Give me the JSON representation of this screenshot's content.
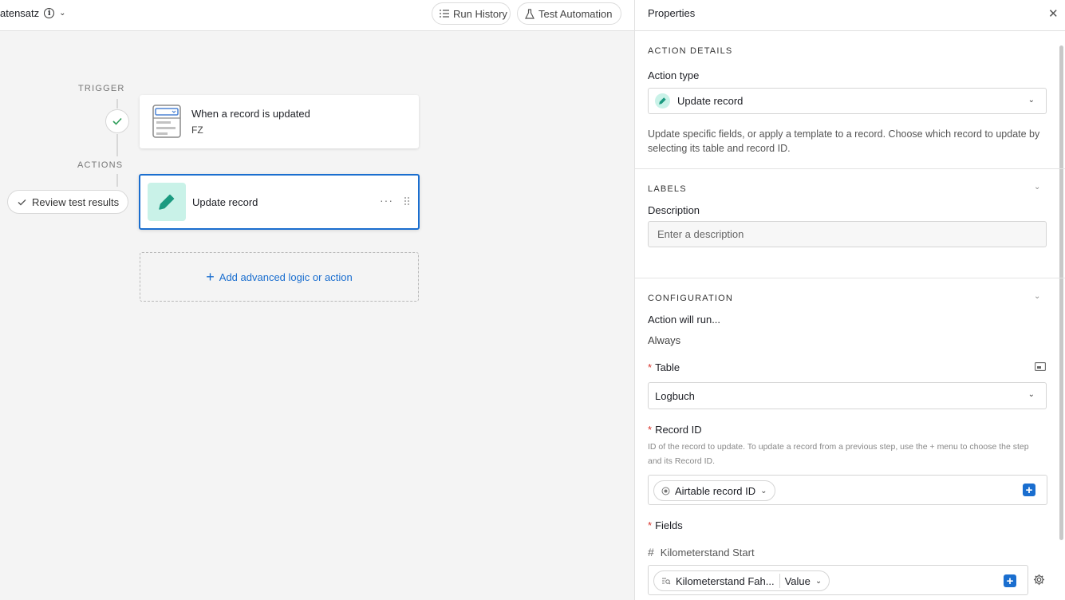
{
  "topbar": {
    "title": "atensatz",
    "run_history": "Run History",
    "test_automation": "Test Automation"
  },
  "canvas": {
    "trigger_label": "TRIGGER",
    "actions_label": "ACTIONS",
    "review_button": "Review test results",
    "trigger_card": {
      "title": "When a record is updated",
      "subtitle": "FZ"
    },
    "action_card": {
      "title": "Update record",
      "more": "···"
    },
    "add_action": "Add advanced logic or action"
  },
  "panel": {
    "title": "Properties",
    "action_details": {
      "heading": "ACTION DETAILS",
      "action_type_label": "Action type",
      "action_type_value": "Update record",
      "description": "Update specific fields, or apply a template to a record. Choose which record to update by selecting its table and record ID."
    },
    "labels": {
      "heading": "LABELS",
      "description_label": "Description",
      "description_placeholder": "Enter a description"
    },
    "configuration": {
      "heading": "CONFIGURATION",
      "runs_label": "Action will run...",
      "runs_value": "Always",
      "table_label": "Table",
      "table_value": "Logbuch",
      "record_id_label": "Record ID",
      "record_id_help": "ID of the record to update. To update a record from a previous step, use the + menu to choose the step and its Record ID.",
      "record_id_token": "Airtable record ID",
      "fields_label": "Fields",
      "field_name": "Kilometerstand Start",
      "field_token": "Kilometerstand Fah...",
      "field_token_mode": "Value"
    }
  }
}
